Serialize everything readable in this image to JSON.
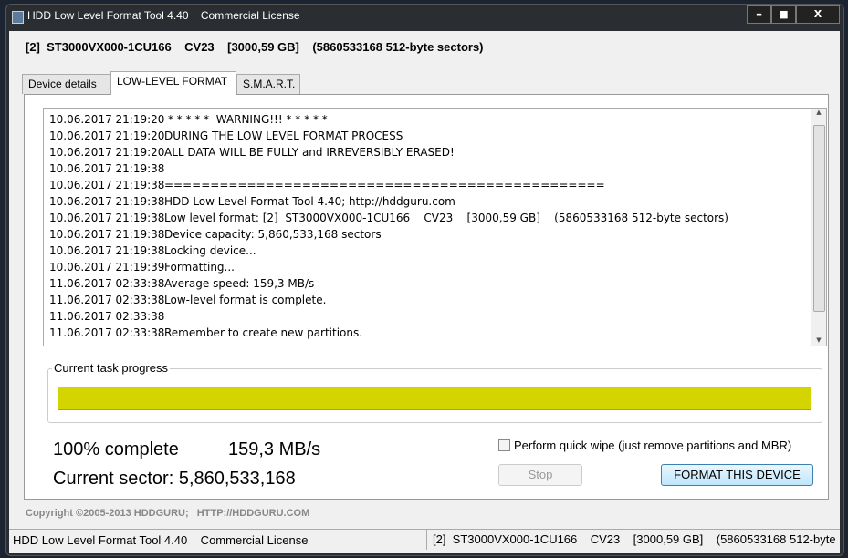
{
  "window": {
    "title": "HDD Low Level Format Tool 4.40    Commercial License",
    "minimize": "▬",
    "maximize": "■",
    "close": "X"
  },
  "device_header": "[2]  ST3000VX000-1CU166    CV23    [3000,59 GB]    (5860533168 512-byte sectors)",
  "tabs": [
    {
      "label": "Device details",
      "active": false
    },
    {
      "label": "LOW-LEVEL FORMAT",
      "active": true
    },
    {
      "label": "S.M.A.R.T.",
      "active": false
    }
  ],
  "log": [
    {
      "ts": "10.06.2017 21:19:20",
      "msg": " * * * * *  WARNING!!! * * * * *"
    },
    {
      "ts": "10.06.2017 21:19:20",
      "msg": "DURING THE LOW LEVEL FORMAT PROCESS"
    },
    {
      "ts": "10.06.2017 21:19:20",
      "msg": "ALL DATA WILL BE FULLY and IRREVERSIBLY ERASED!"
    },
    {
      "ts": "10.06.2017 21:19:38",
      "msg": ""
    },
    {
      "ts": "10.06.2017 21:19:38",
      "msg": "================================================"
    },
    {
      "ts": "10.06.2017 21:19:38",
      "msg": "HDD Low Level Format Tool 4.40; http://hddguru.com"
    },
    {
      "ts": "10.06.2017 21:19:38",
      "msg": "Low level format: [2]  ST3000VX000-1CU166    CV23    [3000,59 GB]    (5860533168 512-byte sectors)"
    },
    {
      "ts": "10.06.2017 21:19:38",
      "msg": "Device capacity: 5,860,533,168 sectors"
    },
    {
      "ts": "10.06.2017 21:19:38",
      "msg": "Locking device..."
    },
    {
      "ts": "10.06.2017 21:19:39",
      "msg": "Formatting..."
    },
    {
      "ts": "11.06.2017 02:33:38",
      "msg": "Average speed: 159,3 MB/s"
    },
    {
      "ts": "11.06.2017 02:33:38",
      "msg": "Low-level format is complete."
    },
    {
      "ts": "11.06.2017 02:33:38",
      "msg": ""
    },
    {
      "ts": "11.06.2017 02:33:38",
      "msg": "Remember to create new partitions."
    }
  ],
  "progress": {
    "label": "Current task progress",
    "percent": 100,
    "color": "#d4d400",
    "complete_text": "100% complete",
    "speed": "159,3 MB/s",
    "sector_text": "Current sector: 5,860,533,168"
  },
  "quick_wipe": {
    "label": "Perform quick wipe (just remove partitions and MBR)",
    "checked": false
  },
  "buttons": {
    "stop": "Stop",
    "format": "FORMAT THIS DEVICE"
  },
  "copyright": "Copyright ©2005-2013 HDDGURU;   HTTP://HDDGURU.COM",
  "statusbar": {
    "left": "HDD Low Level Format Tool 4.40    Commercial License",
    "right": "[2]  ST3000VX000-1CU166    CV23    [3000,59 GB]    (5860533168 512-byte"
  }
}
